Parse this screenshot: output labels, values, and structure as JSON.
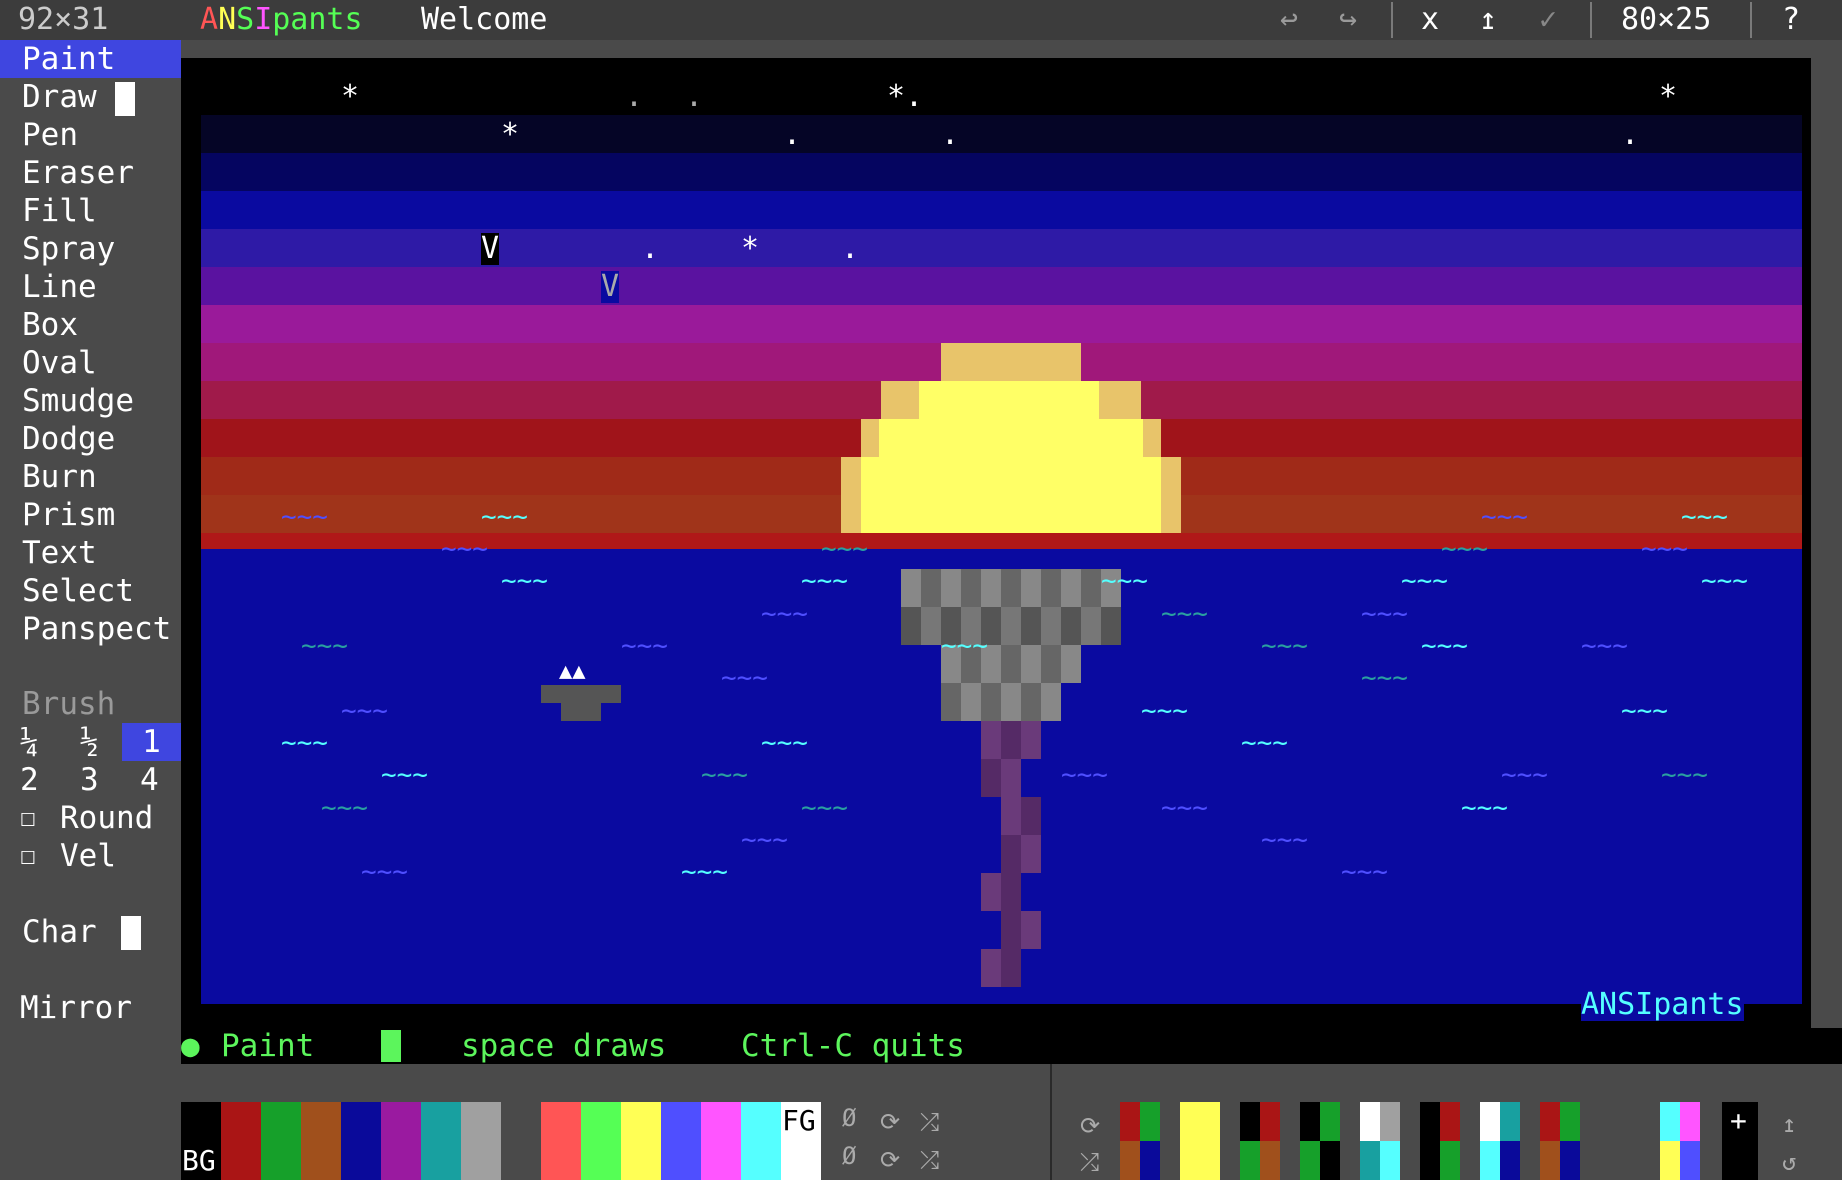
{
  "topbar": {
    "size_readout": "92×31",
    "app_title_letters": [
      {
        "ch": "A",
        "color": "#ff5555"
      },
      {
        "ch": "N",
        "color": "#ffff55"
      },
      {
        "ch": "S",
        "color": "#55ff55"
      },
      {
        "ch": "I",
        "color": "#ff55ff"
      },
      {
        "ch": "pants",
        "color": "#55ff55"
      }
    ],
    "doc_title": "Welcome",
    "undo_icon": "↩",
    "redo_icon": "↪",
    "close_label": "x",
    "export_icon": "↥",
    "confirm_icon": "✓",
    "canvas_size": "80×25",
    "help_label": "?"
  },
  "sidebar": {
    "tools": [
      "Paint",
      "Draw",
      "Pen",
      "Eraser",
      "Fill",
      "Spray",
      "Line",
      "Box",
      "Oval",
      "Smudge",
      "Dodge",
      "Burn",
      "Prism",
      "Text",
      "Select",
      "Panspect"
    ],
    "active_tool": "Paint",
    "brush_heading": "Brush",
    "brush_sizes_row1": [
      "¼",
      "½",
      "1"
    ],
    "brush_sizes_row2": [
      "2",
      "3",
      "4"
    ],
    "brush_selected": "1",
    "checkbox_symbol": "☐",
    "round_label": "Round",
    "vel_label": "Vel",
    "char_label": "Char",
    "mirror_label": "Mirror",
    "swap_icon": "⇄"
  },
  "canvas": {
    "watermark": "ANSIpants",
    "sky_stars": [
      "*",
      ".",
      ".",
      "*.",
      "*",
      "*",
      ".",
      ".",
      ".",
      "V",
      ".",
      "*",
      ".",
      "V"
    ],
    "wave_glyph": "~~~",
    "sail_glyph": "▲▲"
  },
  "status": {
    "mode_dot": "●",
    "mode_label": "Paint",
    "hint1": "space draws",
    "hint2": "Ctrl-C quits"
  },
  "palette": {
    "bg_label": "BG",
    "fg_label": "FG",
    "base_colors": [
      "#000000",
      "#aa1515",
      "#16a02a",
      "#a0501c",
      "#0a0a9a",
      "#9a1aa0",
      "#18a0a0",
      "#a0a0a0"
    ],
    "bright_colors": [
      "#ff5555",
      "#55ff55",
      "#ffff55",
      "#4f4fff",
      "#ff55ff",
      "#55ffff",
      "#ffffff"
    ],
    "none_symbol": "Ø",
    "cycle_icon": "⟳",
    "shuffle_icon": "⤮",
    "add_icon": "+",
    "upload_icon": "↥",
    "reset_icon": "↺"
  },
  "colors": {
    "accent": "#3f46e0",
    "status_green": "#5cf55c",
    "watermark": "#55ffff",
    "sea": "#0a0aa0",
    "sun": "#ffff66"
  }
}
